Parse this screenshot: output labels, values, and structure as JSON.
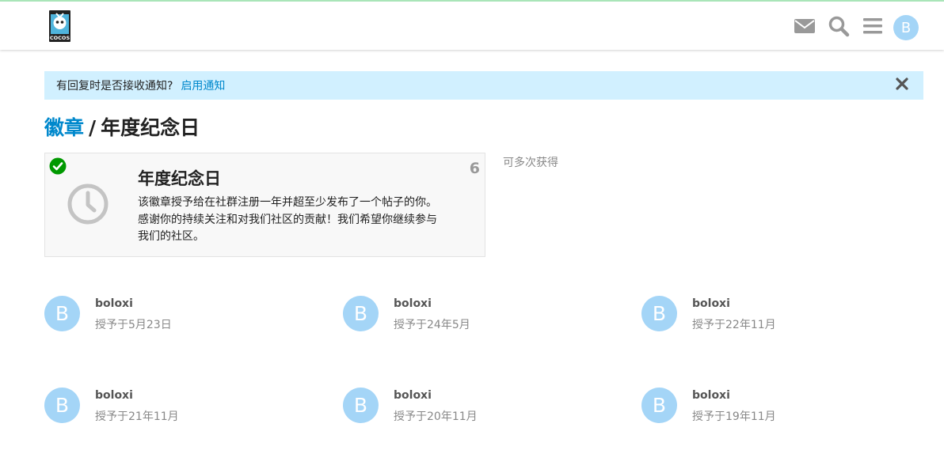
{
  "header": {
    "logo_text": "COCOS",
    "icons": [
      "mail-icon",
      "search-icon",
      "hamburger-menu-icon"
    ],
    "avatar_letter": "B"
  },
  "notice": {
    "text": "有回复时是否接收通知?",
    "link": "启用通知",
    "close_icon": "close-icon"
  },
  "breadcrumb": {
    "parent": "徽章",
    "separator": "/",
    "current": "年度纪念日"
  },
  "badge": {
    "name": "年度纪念日",
    "count": "6",
    "description": "该徽章授予给在社群注册一年并超至少发布了一个帖子的你。感谢你的持续关注和对我们社区的贡献！我们希望你继续参与我们的社区。",
    "icon": "clock-icon",
    "status_icon": "check-circle-icon",
    "grant_note": "可多次获得"
  },
  "grants": [
    {
      "avatar_letter": "B",
      "user": "boloxi",
      "granted": "授予于5月23日"
    },
    {
      "avatar_letter": "B",
      "user": "boloxi",
      "granted": "授予于24年5月"
    },
    {
      "avatar_letter": "B",
      "user": "boloxi",
      "granted": "授予于22年11月"
    },
    {
      "avatar_letter": "B",
      "user": "boloxi",
      "granted": "授予于21年11月"
    },
    {
      "avatar_letter": "B",
      "user": "boloxi",
      "granted": "授予于20年11月"
    },
    {
      "avatar_letter": "B",
      "user": "boloxi",
      "granted": "授予于19年11月"
    }
  ],
  "colors": {
    "accent": "#0088cc",
    "notice_bg": "#d1f0ff",
    "avatar_bg": "#a4d5f7",
    "check_green": "#009900"
  }
}
